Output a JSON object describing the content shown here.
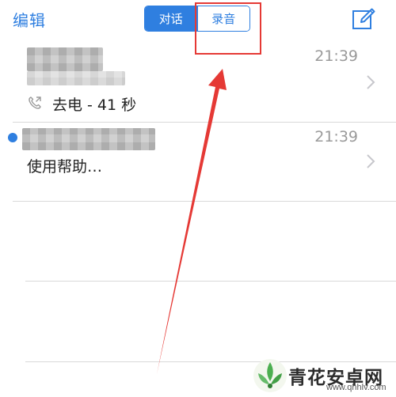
{
  "nav": {
    "edit_label": "编辑",
    "segments": [
      {
        "label": "对话",
        "active": true
      },
      {
        "label": "录音",
        "active": false
      }
    ],
    "compose_icon": "compose-icon"
  },
  "conversations": [
    {
      "time": "21:39",
      "detail": "去电 - 41 秒",
      "unread": false,
      "detail_icon": "phone-outgoing-icon"
    },
    {
      "time": "21:39",
      "detail": "使用帮助…",
      "unread": true
    }
  ],
  "watermark": {
    "name": "青花安卓网",
    "url": "www.qhhlv.com"
  },
  "colors": {
    "accent": "#2f7fe0",
    "annotation": "#e53935"
  }
}
